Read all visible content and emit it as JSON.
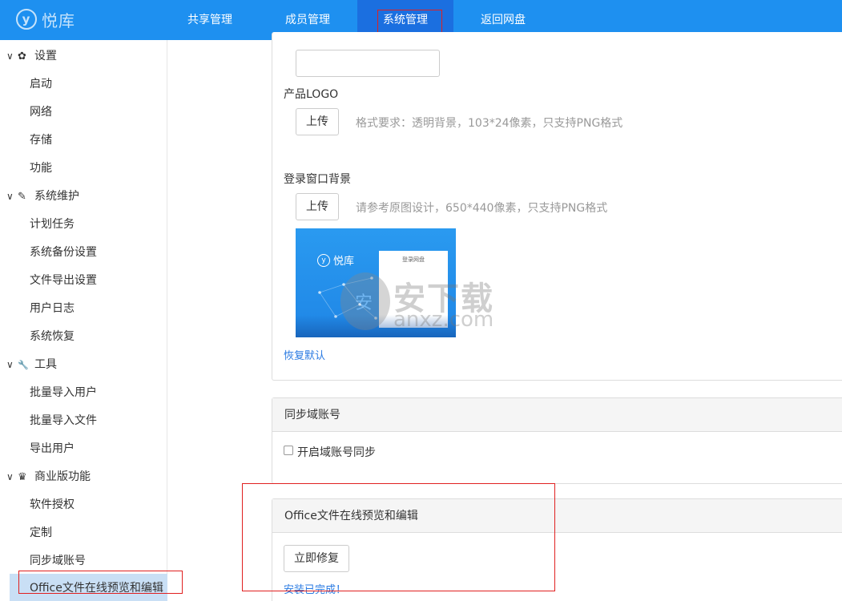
{
  "header": {
    "logo_text": "悦库",
    "logo_mark": "y",
    "nav": [
      {
        "label": "共享管理"
      },
      {
        "label": "成员管理"
      },
      {
        "label": "系统管理"
      },
      {
        "label": "返回网盘"
      }
    ]
  },
  "sidebar": {
    "groups": [
      {
        "label": "设置",
        "icon": "gear-icon",
        "glyph": "✿",
        "items": [
          "启动",
          "网络",
          "存储",
          "功能"
        ]
      },
      {
        "label": "系统维护",
        "icon": "brush-icon",
        "glyph": "✎",
        "items": [
          "计划任务",
          "系统备份设置",
          "文件导出设置",
          "用户日志",
          "系统恢复"
        ]
      },
      {
        "label": "工具",
        "icon": "wrench-icon",
        "glyph": "🔧",
        "items": [
          "批量导入用户",
          "批量导入文件",
          "导出用户"
        ]
      },
      {
        "label": "商业版功能",
        "icon": "crown-icon",
        "glyph": "♛",
        "items": [
          "软件授权",
          "定制",
          "同步域账号",
          "Office文件在线预览和编辑"
        ]
      }
    ],
    "chevron": "∨"
  },
  "main": {
    "product_logo_label": "产品LOGO",
    "upload_label": "上传",
    "logo_hint": "格式要求：透明背景，103*24像素，只支持PNG格式",
    "login_bg_label": "登录窗口背景",
    "login_bg_hint": "请参考原图设计，650*440像素，只支持PNG格式",
    "preview_logo_text": "悦库",
    "preview_login_title": "登录网盘",
    "restore_default": "恢复默认",
    "sync_panel_title": "同步域账号",
    "sync_checkbox_label": "开启域账号同步",
    "office_panel_title": "Office文件在线预览和编辑",
    "repair_button": "立即修复",
    "install_status": "安装已完成！"
  },
  "watermark": {
    "glyph": "安",
    "big": "安下载",
    "small": "anxz.com"
  },
  "colors": {
    "topbar": "#1e90f0",
    "active_nav": "#1b6fe0",
    "highlight_red": "#e02020",
    "link": "#2a7ae2"
  }
}
